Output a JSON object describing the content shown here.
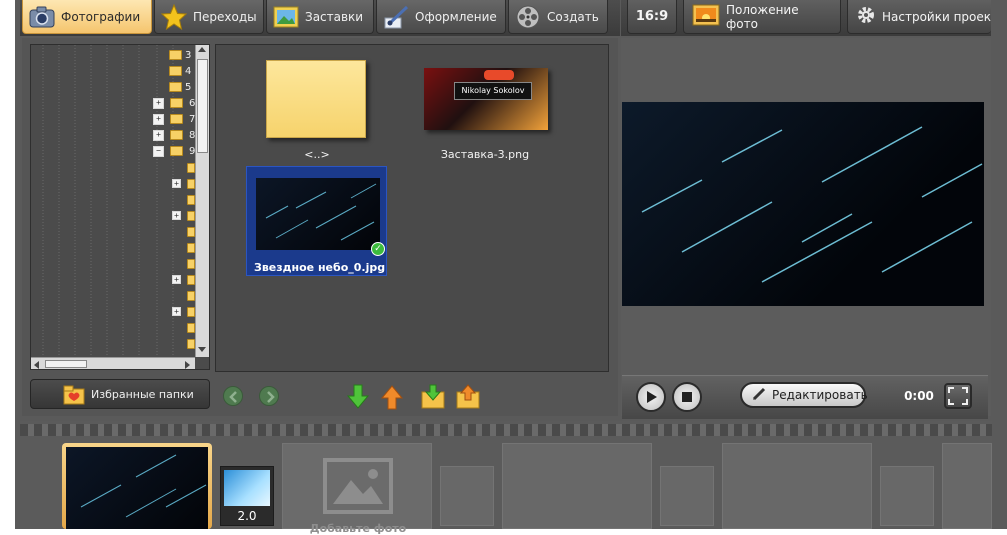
{
  "tabs": [
    {
      "label": "Фотографии",
      "icon": "camera-icon"
    },
    {
      "label": "Переходы",
      "icon": "star-icon"
    },
    {
      "label": "Заставки",
      "icon": "landscape-picture-icon"
    },
    {
      "label": "Оформление",
      "icon": "brush-icon"
    },
    {
      "label": "Создать",
      "icon": "film-reel-icon"
    }
  ],
  "right_toolbar": {
    "aspect": "16:9",
    "photo_position": "Положение фото",
    "project_settings": "Настройки проек"
  },
  "tree": {
    "rows": [
      "3",
      "4",
      "5",
      "6",
      "7",
      "8",
      "9"
    ]
  },
  "files": [
    {
      "name": "<..>",
      "type": "folder"
    },
    {
      "name": "Заставка-3.png",
      "type": "image",
      "thumb_text": "Nikolay Sokolov"
    },
    {
      "name": "Звездное небо_0.jpg",
      "type": "image",
      "selected": true
    }
  ],
  "left_bottom": {
    "favorites": "Избранные папки"
  },
  "player": {
    "edit": "Редактировать",
    "time": "0:00"
  },
  "filmstrip": {
    "transition_duration": "2.0",
    "add_photo": "Добавьте фото"
  },
  "colors": {
    "active_tab": "#f5c56e",
    "selection": "#1b3a8c",
    "check_green": "#3dbb3d"
  }
}
